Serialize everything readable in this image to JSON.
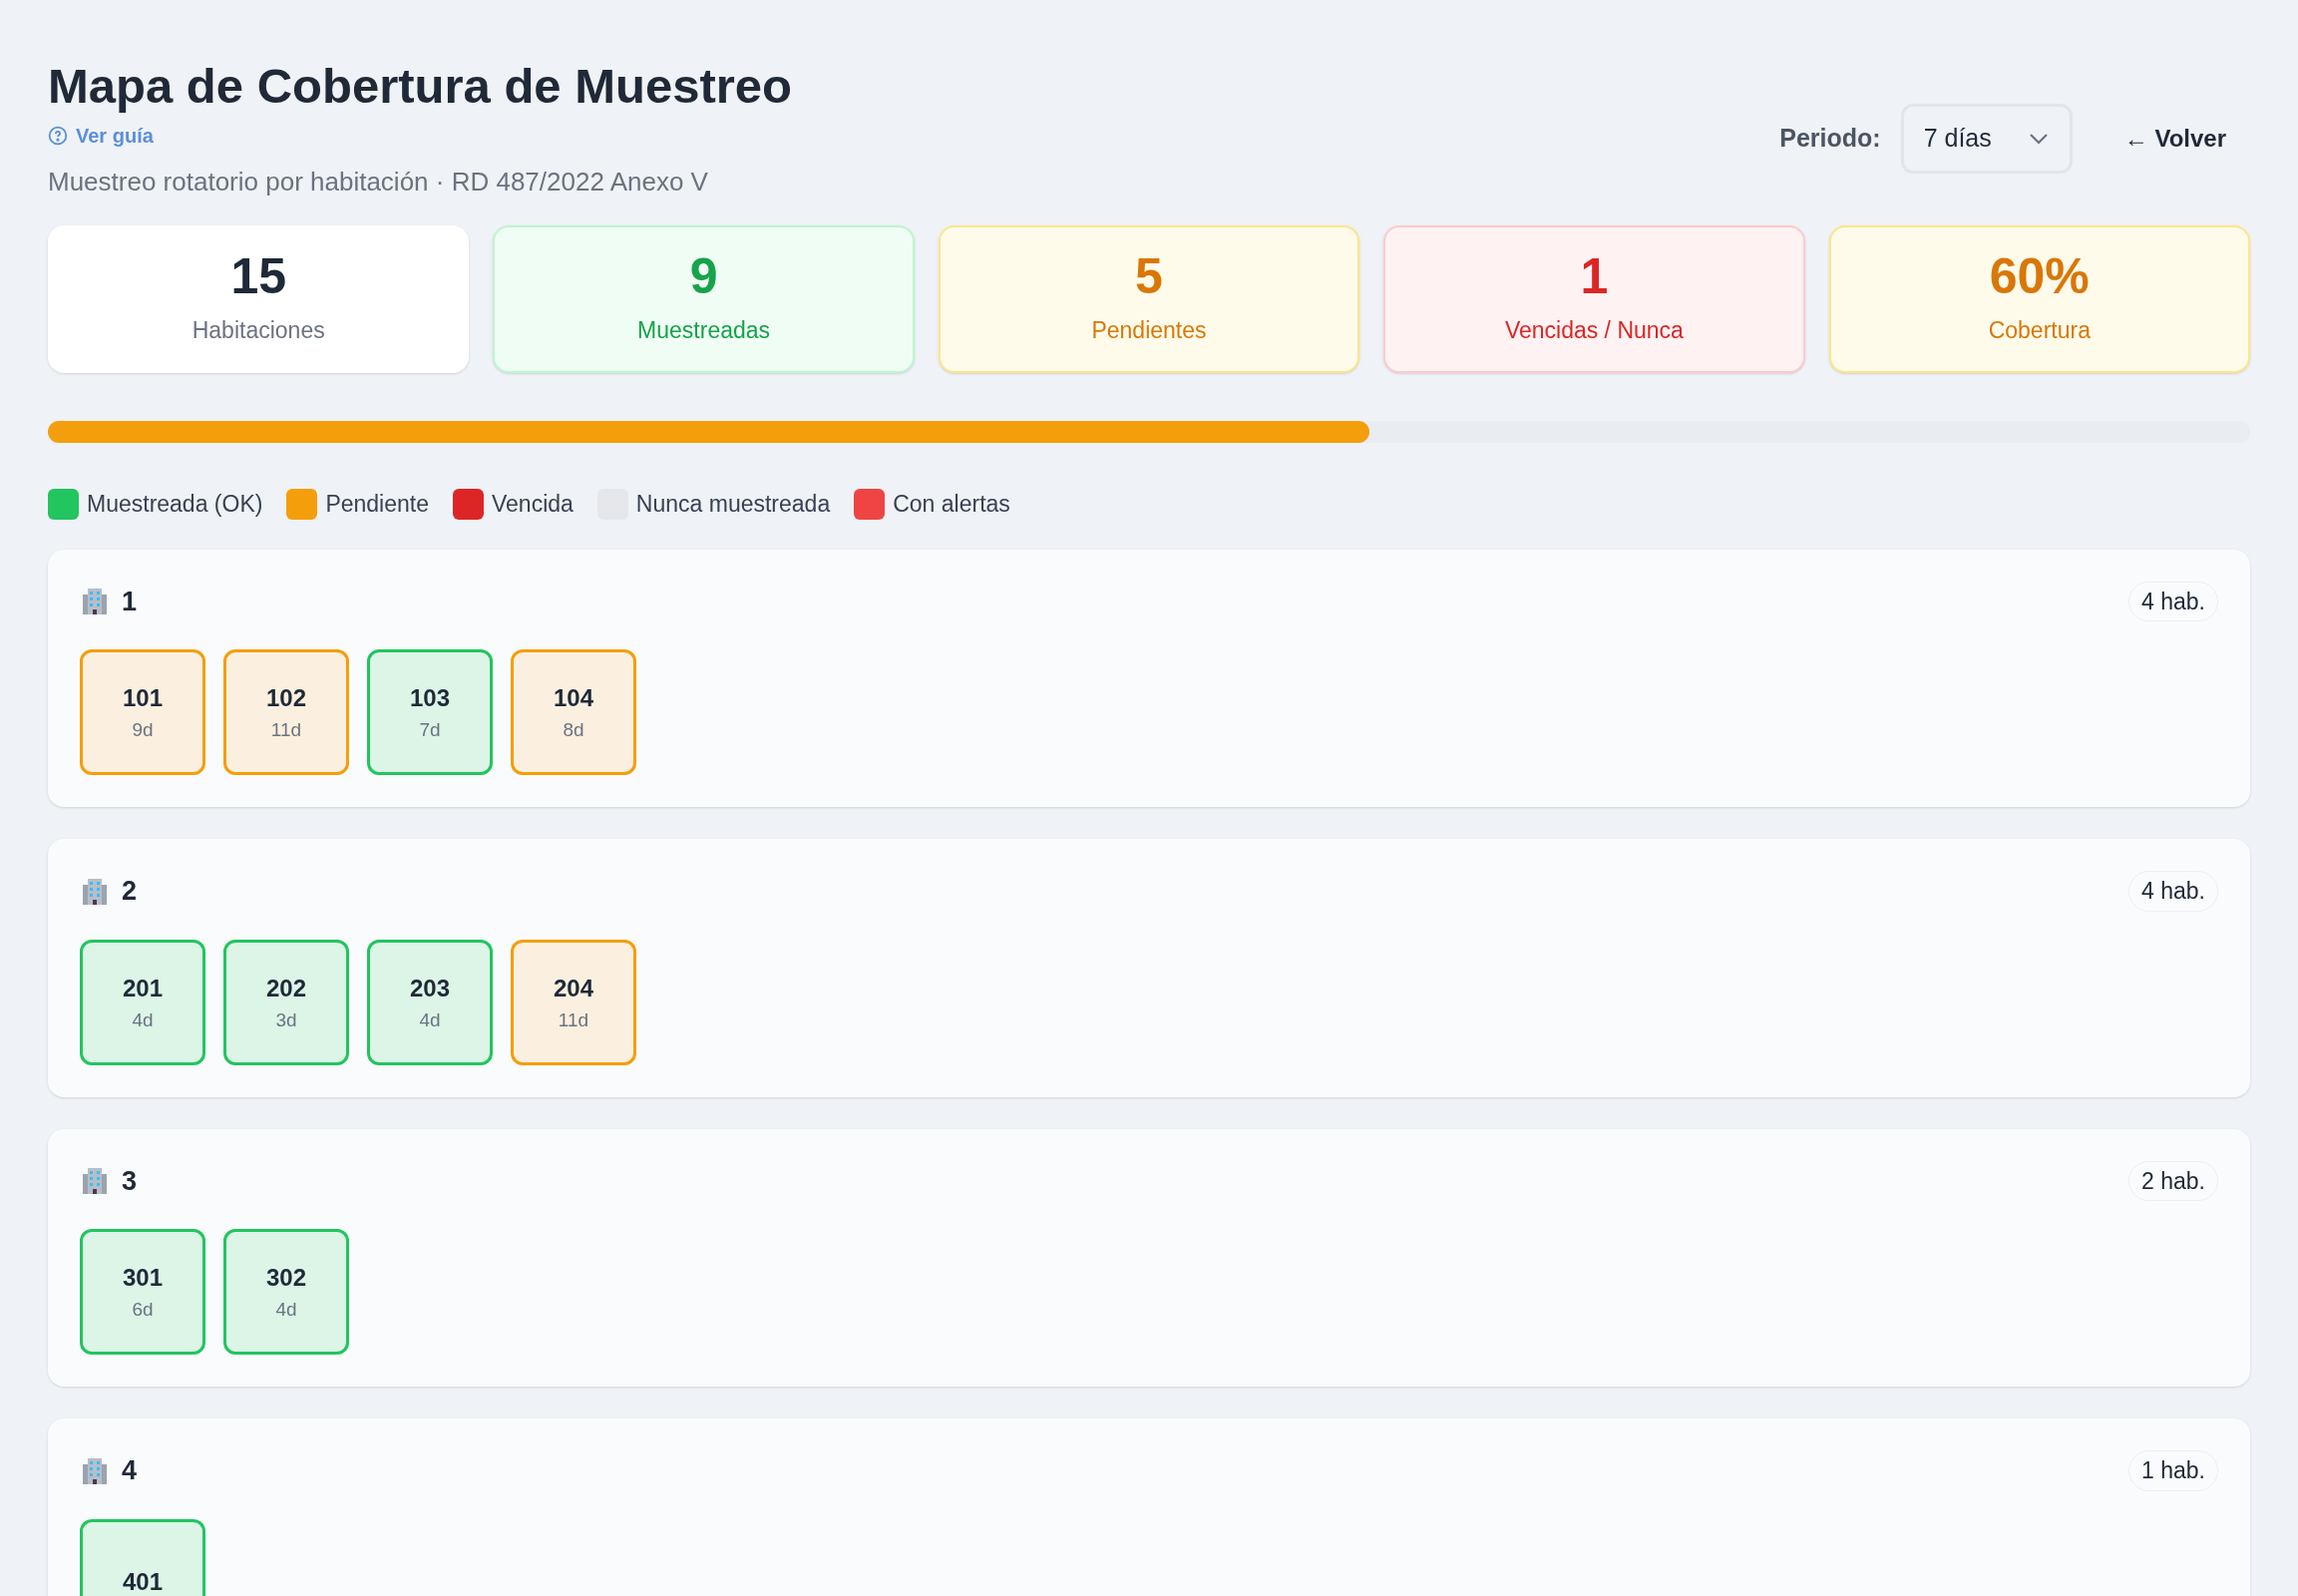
{
  "header": {
    "title": "Mapa de Cobertura de Muestreo",
    "guide_link": "Ver guía",
    "subtitle": "Muestreo rotatorio por habitación · RD 487/2022 Anexo V",
    "period_label": "Periodo:",
    "period_value": "7 días",
    "back_link": "← Volver"
  },
  "stats": [
    {
      "value": "15",
      "label": "Habitaciones",
      "kind": "neutral"
    },
    {
      "value": "9",
      "label": "Muestreadas",
      "kind": "green"
    },
    {
      "value": "5",
      "label": "Pendientes",
      "kind": "amber"
    },
    {
      "value": "1",
      "label": "Vencidas / Nunca",
      "kind": "red"
    },
    {
      "value": "60%",
      "label": "Cobertura",
      "kind": "amber"
    }
  ],
  "coverage_bar": {
    "level": 0.6
  },
  "legend": [
    {
      "label": "Muestreada (OK)",
      "color": "#22c55e"
    },
    {
      "label": "Pendiente",
      "color": "#f59e0b"
    },
    {
      "label": "Vencida",
      "color": "#dc2626"
    },
    {
      "label": "Nunca muestreada",
      "color": "#e5e7eb"
    },
    {
      "label": "Con alertas",
      "color": "#ef4444"
    }
  ],
  "floors": [
    {
      "name": "1",
      "count": "4 hab.",
      "rooms": [
        {
          "number": "101",
          "days": "9d",
          "kind": "pending"
        },
        {
          "number": "102",
          "days": "11d",
          "kind": "pending"
        },
        {
          "number": "103",
          "days": "7d",
          "kind": "ok"
        },
        {
          "number": "104",
          "days": "8d",
          "kind": "pending"
        }
      ]
    },
    {
      "name": "2",
      "count": "4 hab.",
      "rooms": [
        {
          "number": "201",
          "days": "4d",
          "kind": "ok"
        },
        {
          "number": "202",
          "days": "3d",
          "kind": "ok"
        },
        {
          "number": "203",
          "days": "4d",
          "kind": "ok"
        },
        {
          "number": "204",
          "days": "11d",
          "kind": "pending"
        }
      ]
    },
    {
      "name": "3",
      "count": "2 hab.",
      "rooms": [
        {
          "number": "301",
          "days": "6d",
          "kind": "ok"
        },
        {
          "number": "302",
          "days": "4d",
          "kind": "ok"
        }
      ]
    },
    {
      "name": "4",
      "count": "1 hab.",
      "rooms": [
        {
          "number": "401",
          "kind": "ok"
        }
      ]
    }
  ]
}
